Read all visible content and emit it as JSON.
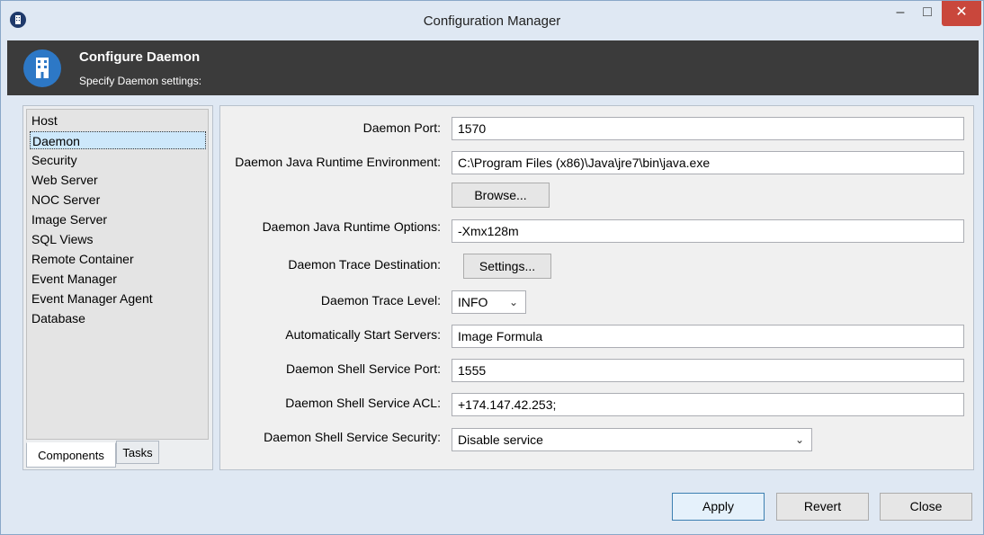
{
  "window": {
    "title": "Configuration Manager",
    "controls": {
      "minimize": "–",
      "maximize": "□",
      "close": "✕"
    }
  },
  "header": {
    "title": "Configure Daemon",
    "subtitle": "Specify Daemon settings:",
    "icon": "building-icon"
  },
  "sidebar": {
    "items": [
      {
        "label": "Host",
        "selected": false
      },
      {
        "label": "Daemon",
        "selected": true
      },
      {
        "label": "Security",
        "selected": false
      },
      {
        "label": "Web Server",
        "selected": false
      },
      {
        "label": "NOC Server",
        "selected": false
      },
      {
        "label": "Image Server",
        "selected": false
      },
      {
        "label": "SQL Views",
        "selected": false
      },
      {
        "label": "Remote Container",
        "selected": false
      },
      {
        "label": "Event Manager",
        "selected": false
      },
      {
        "label": "Event Manager Agent",
        "selected": false
      },
      {
        "label": "Database",
        "selected": false
      }
    ],
    "tabs": [
      {
        "label": "Components",
        "active": true
      },
      {
        "label": "Tasks",
        "active": false
      }
    ]
  },
  "form": {
    "daemon_port": {
      "label": "Daemon Port:",
      "value": "1570"
    },
    "jre": {
      "label": "Daemon Java Runtime Environment:",
      "value": "C:\\Program Files (x86)\\Java\\jre7\\bin\\java.exe",
      "browse_label": "Browse..."
    },
    "jre_options": {
      "label": "Daemon Java Runtime Options:",
      "value": "-Xmx128m"
    },
    "trace_destination": {
      "label": "Daemon Trace Destination:",
      "button_label": "Settings..."
    },
    "trace_level": {
      "label": "Daemon Trace Level:",
      "value": "INFO"
    },
    "auto_start": {
      "label": "Automatically Start Servers:",
      "value": "Image Formula"
    },
    "shell_port": {
      "label": "Daemon Shell Service Port:",
      "value": "1555"
    },
    "shell_acl": {
      "label": "Daemon Shell Service ACL:",
      "value": "+174.147.42.253;"
    },
    "shell_security": {
      "label": "Daemon Shell Service Security:",
      "value": "Disable service"
    }
  },
  "footer": {
    "apply": "Apply",
    "revert": "Revert",
    "close": "Close"
  },
  "colors": {
    "header_bg": "#3b3b3b",
    "accent": "#2d78c6",
    "selected_item": "#cde8fb",
    "close_button": "#c9473c"
  }
}
